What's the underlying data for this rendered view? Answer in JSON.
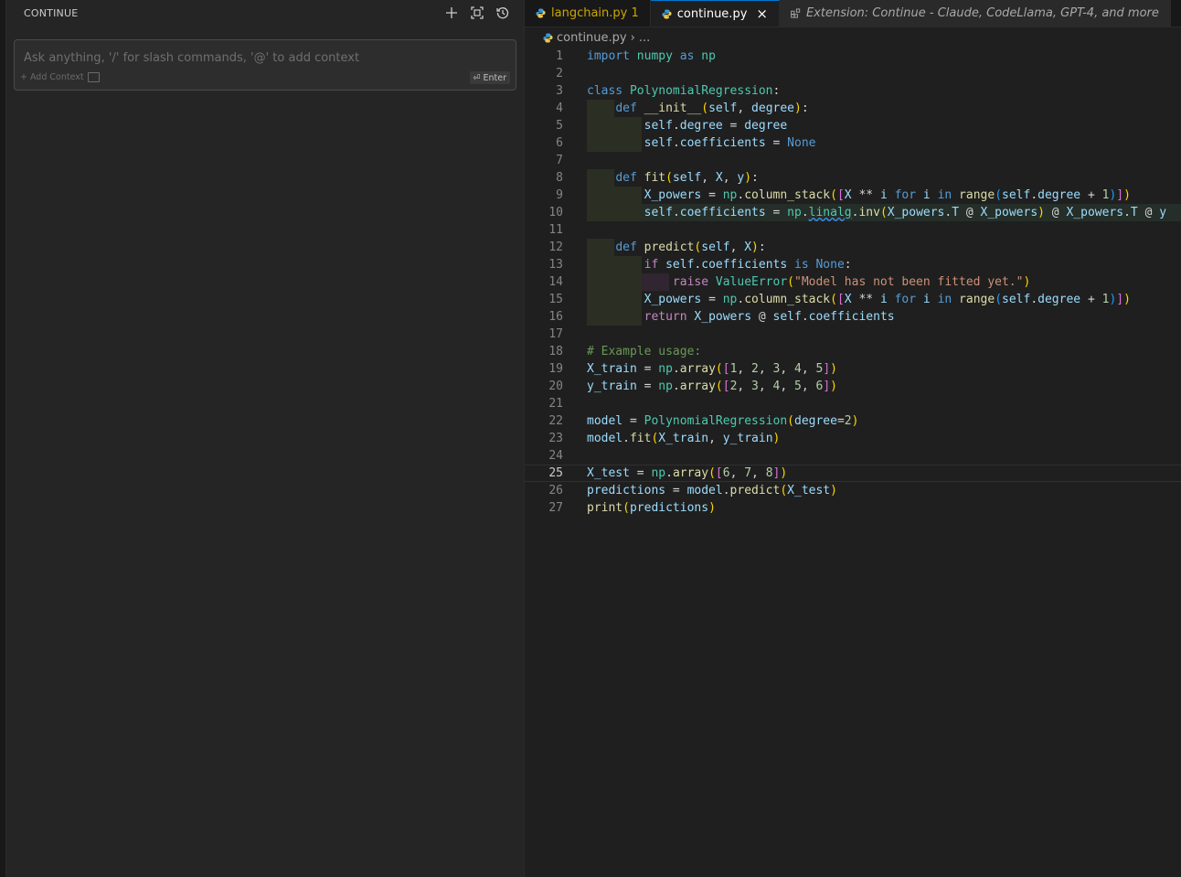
{
  "side_panel": {
    "title": "CONTINUE",
    "actions": [
      {
        "name": "new-session-button",
        "icon": "plus-icon"
      },
      {
        "name": "fullscreen-button",
        "icon": "fullscreen-icon"
      },
      {
        "name": "history-button",
        "icon": "history-icon"
      }
    ],
    "chat": {
      "placeholder": "Ask anything, '/' for slash commands, '@' to add context",
      "add_context": "+ Add Context",
      "enter_label": "⏎ Enter"
    }
  },
  "tabs": [
    {
      "label": "langchain.py",
      "badge": "1",
      "state": "warning",
      "icon": "python-icon"
    },
    {
      "label": "continue.py",
      "state": "active",
      "icon": "python-icon",
      "close": "×"
    },
    {
      "label": "Extension: Continue - Claude, CodeLlama, GPT-4, and more",
      "state": "preview",
      "icon": "extension-icon"
    }
  ],
  "breadcrumb": {
    "file": "continue.py",
    "separator": "›",
    "rest": "..."
  },
  "editor": {
    "current_line": 25,
    "line_numbers": [
      "1",
      "2",
      "3",
      "4",
      "5",
      "6",
      "7",
      "8",
      "9",
      "10",
      "11",
      "12",
      "13",
      "14",
      "15",
      "16",
      "17",
      "18",
      "19",
      "20",
      "21",
      "22",
      "23",
      "24",
      "25",
      "26",
      "27"
    ]
  },
  "code_lines": [
    "import numpy as np",
    "",
    "class PolynomialRegression:",
    "    def __init__(self, degree):",
    "        self.degree = degree",
    "        self.coefficients = None",
    "",
    "    def fit(self, X, y):",
    "        X_powers = np.column_stack([X ** i for i in range(self.degree + 1)])",
    "        self.coefficients = np.linalg.inv(X_powers.T @ X_powers) @ X_powers.T @ y",
    "",
    "    def predict(self, X):",
    "        if self.coefficients is None:",
    "            raise ValueError(\"Model has not been fitted yet.\")",
    "        X_powers = np.column_stack([X ** i for i in range(self.degree + 1)])",
    "        return X_powers @ self.coefficients",
    "",
    "# Example usage:",
    "X_train = np.array([1, 2, 3, 4, 5])",
    "y_train = np.array([2, 3, 4, 5, 6])",
    "",
    "model = PolynomialRegression(degree=2)",
    "model.fit(X_train, y_train)",
    "",
    "X_test = np.array([6, 7, 8])",
    "predictions = model.predict(X_test)",
    "print(predictions)"
  ]
}
